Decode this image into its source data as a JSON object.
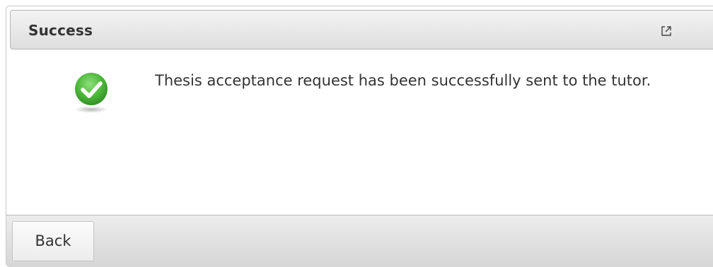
{
  "dialog": {
    "title": "Success",
    "message": "Thesis acceptance request has been successfully sent to the tutor.",
    "status_icon": "checkmark-circle-icon",
    "popout_icon": "popout-icon",
    "accent_color": "#3aa52a"
  },
  "footer": {
    "back_label": "Back"
  }
}
